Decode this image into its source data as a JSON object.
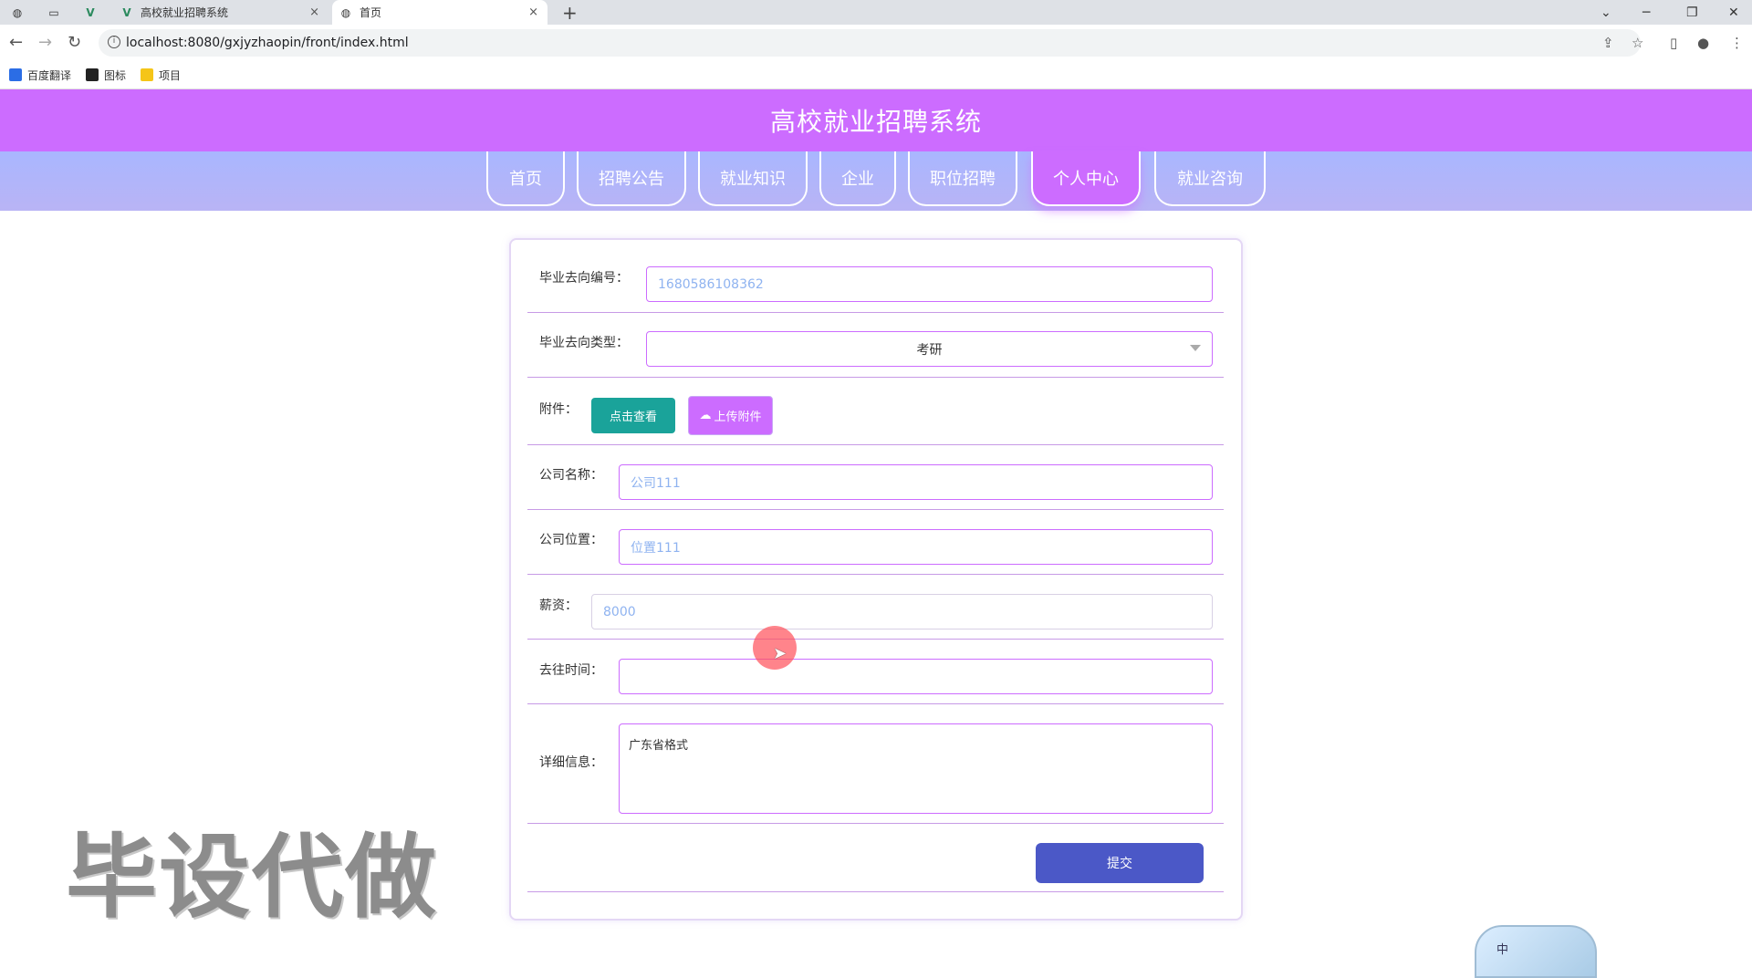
{
  "browser": {
    "tabs": [
      {
        "label": "",
        "icon": "globe-icon"
      },
      {
        "label": "",
        "icon": "blank-page-icon"
      },
      {
        "label": "",
        "icon": "vue-logo-icon"
      },
      {
        "label": "高校就业招聘系统",
        "icon": "vue-logo-icon",
        "close": "×"
      },
      {
        "label": "首页",
        "icon": "globe-icon",
        "close": "×",
        "active": true
      }
    ],
    "new_tab": "+",
    "url": "localhost:8080/gxjyzhaopin/front/index.html",
    "bookmarks": [
      {
        "label": "百度翻译",
        "color": "#2b6de5"
      },
      {
        "label": "图标",
        "color": "#222222"
      },
      {
        "label": "项目",
        "color": "#f5c518"
      }
    ]
  },
  "site": {
    "title": "高校就业招聘系统",
    "nav": [
      "首页",
      "招聘公告",
      "就业知识",
      "企业",
      "职位招聘",
      "个人中心",
      "就业咨询"
    ],
    "active_nav": "个人中心",
    "colors": {
      "header": "#cc6cff",
      "nav_band": "#b1b5fa",
      "submit": "#4b58c7",
      "view_button": "#1aa39a"
    }
  },
  "form": {
    "number": {
      "label": "毕业去向编号：",
      "value": "1680586108362"
    },
    "type": {
      "label": "毕业去向类型：",
      "value": "考研"
    },
    "attachment": {
      "label": "附件：",
      "view_label": "点击查看",
      "upload_label": "上传附件"
    },
    "company_name": {
      "label": "公司名称：",
      "value": "公司111"
    },
    "company_location": {
      "label": "公司位置：",
      "value": "位置111"
    },
    "salary": {
      "label": "薪资：",
      "value": "8000"
    },
    "departure_time": {
      "label": "去往时间：",
      "value": ""
    },
    "details": {
      "label": "详细信息：",
      "value": "广东省格式"
    },
    "submit_label": "提交"
  },
  "overlay": {
    "watermark": "毕设代做",
    "ime_label": "中"
  }
}
